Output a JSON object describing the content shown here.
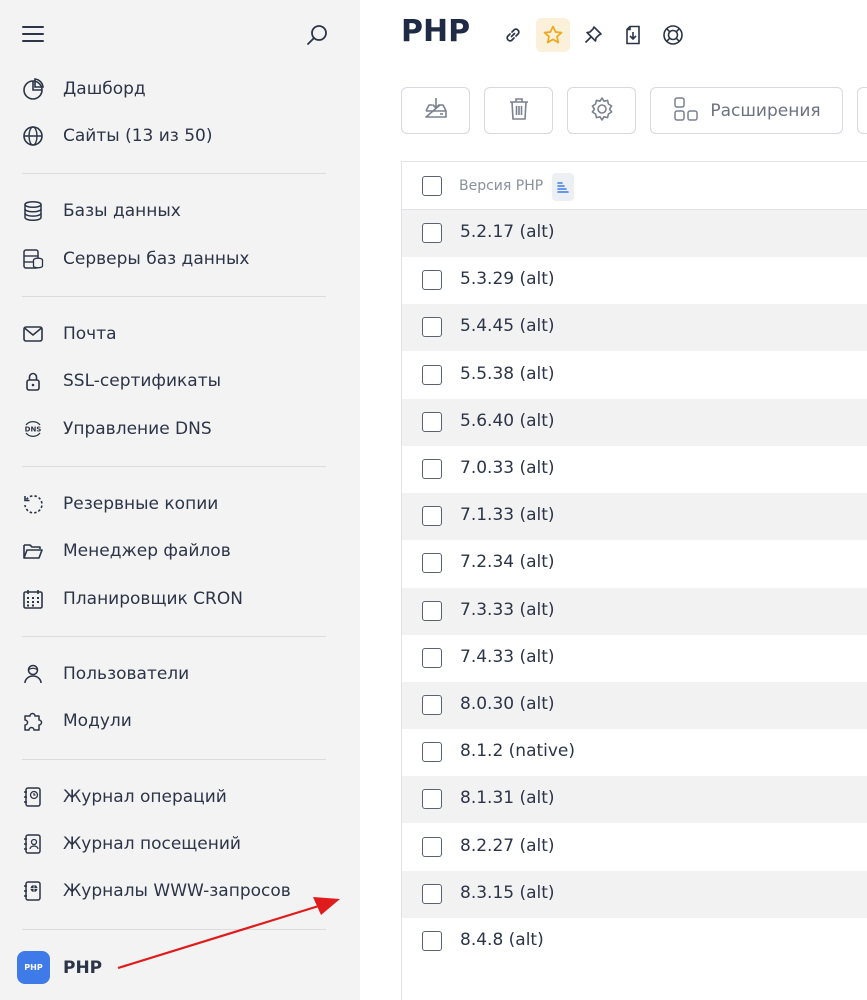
{
  "sidebar": {
    "menu_icon": "hamburger-icon",
    "search_icon": "search-icon",
    "items": [
      {
        "label": "Дашборд",
        "icon": "pie-chart-icon"
      },
      {
        "label": "Сайты (13 из 50)",
        "icon": "globe-icon"
      },
      {
        "label": "Базы данных",
        "icon": "database-icon"
      },
      {
        "label": "Серверы баз данных",
        "icon": "database-server-icon"
      },
      {
        "label": "Почта",
        "icon": "mail-icon"
      },
      {
        "label": "SSL-сертификаты",
        "icon": "lock-icon"
      },
      {
        "label": "Управление DNS",
        "icon": "dns-icon"
      },
      {
        "label": "Резервные копии",
        "icon": "backup-icon"
      },
      {
        "label": "Менеджер файлов",
        "icon": "folder-icon"
      },
      {
        "label": "Планировщик CRON",
        "icon": "calendar-icon"
      },
      {
        "label": "Пользователи",
        "icon": "user-icon"
      },
      {
        "label": "Модули",
        "icon": "puzzle-icon"
      },
      {
        "label": "Журнал операций",
        "icon": "operations-log-icon"
      },
      {
        "label": "Журнал посещений",
        "icon": "visits-log-icon"
      },
      {
        "label": "Журналы WWW-запросов",
        "icon": "www-log-icon"
      },
      {
        "label": "PHP",
        "icon": "php-icon",
        "badge": "PHP"
      }
    ]
  },
  "header": {
    "title": "PHP",
    "icons": [
      "link-icon",
      "star-icon",
      "pin-icon",
      "download-doc-icon",
      "help-icon"
    ]
  },
  "toolbar": {
    "buttons": [
      {
        "icon": "install-icon"
      },
      {
        "icon": "trash-icon"
      },
      {
        "icon": "gear-icon"
      },
      {
        "icon": "extensions-icon",
        "label": "Расширения"
      }
    ]
  },
  "table": {
    "column_header": "Версия PHP",
    "rows": [
      "5.2.17 (alt)",
      "5.3.29 (alt)",
      "5.4.45 (alt)",
      "5.5.38 (alt)",
      "5.6.40 (alt)",
      "7.0.33 (alt)",
      "7.1.33 (alt)",
      "7.2.34 (alt)",
      "7.3.33 (alt)",
      "7.4.33 (alt)",
      "8.0.30 (alt)",
      "8.1.2 (native)",
      "8.1.31 (alt)",
      "8.2.27 (alt)",
      "8.3.15 (alt)",
      "8.4.8 (alt)"
    ]
  },
  "colors": {
    "sidebar_bg": "#f3f3f3",
    "text": "#2b3547",
    "accent": "#3f7be8",
    "star_bg": "#fbf0d9",
    "star": "#f0a81b",
    "arrow": "#e01b1b",
    "row_alt": "#f2f2f2"
  }
}
